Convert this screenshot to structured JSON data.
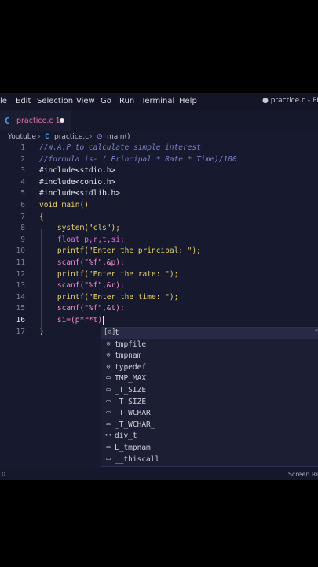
{
  "menu": {
    "items": [
      "le",
      "Edit",
      "Selection",
      "View",
      "Go",
      "Run",
      "Terminal",
      "Help"
    ],
    "window_title": "● practice.c - PROG"
  },
  "tab": {
    "label": "practice.c 1"
  },
  "breadcrumb": {
    "folder": "Youtube",
    "file": "practice.c",
    "symbol": "main()"
  },
  "code": {
    "line_numbers": [
      "1",
      "2",
      "3",
      "4",
      "5",
      "6",
      "7",
      "8",
      "9",
      "10",
      "11",
      "12",
      "13",
      "14",
      "15",
      "16",
      "17"
    ],
    "lines": [
      "//W.A.P to calculate simple interest",
      "//formula is- ( Principal * Rate * Time)/100",
      "#include<stdio.h>",
      "#include<conio.h>",
      "#include<stdlib.h>",
      "void main()",
      "{",
      "    system(\"cls\");",
      "    float p,r,t,si;",
      "    printf(\"Enter the principal: \");",
      "    scanf(\"%f\",&p);",
      "    printf(\"Enter the rate: \");",
      "    scanf(\"%f\",&r);",
      "    printf(\"Enter the time: \");",
      "    scanf(\"%f\",&t);",
      "    si=(p*r*t)",
      "}"
    ]
  },
  "suggestions": {
    "items": [
      {
        "icon": "[⊙]",
        "label": "t"
      },
      {
        "icon": "⊙",
        "label": "tmpfile"
      },
      {
        "icon": "⊙",
        "label": "tmpnam"
      },
      {
        "icon": "⊙",
        "label": "typedef"
      },
      {
        "icon": "▭",
        "label": "TMP_MAX"
      },
      {
        "icon": "▭",
        "label": "_T_SIZE"
      },
      {
        "icon": "▭",
        "label": "_T_SIZE_"
      },
      {
        "icon": "▭",
        "label": "_T_WCHAR"
      },
      {
        "icon": "▭",
        "label": "_T_WCHAR_"
      },
      {
        "icon": "⊶",
        "label": "div_t"
      },
      {
        "icon": "▭",
        "label": "L_tmpnam"
      },
      {
        "icon": "▭",
        "label": "__thiscall"
      }
    ],
    "more": "f"
  },
  "status": {
    "left": "0",
    "right": "Screen Re"
  }
}
